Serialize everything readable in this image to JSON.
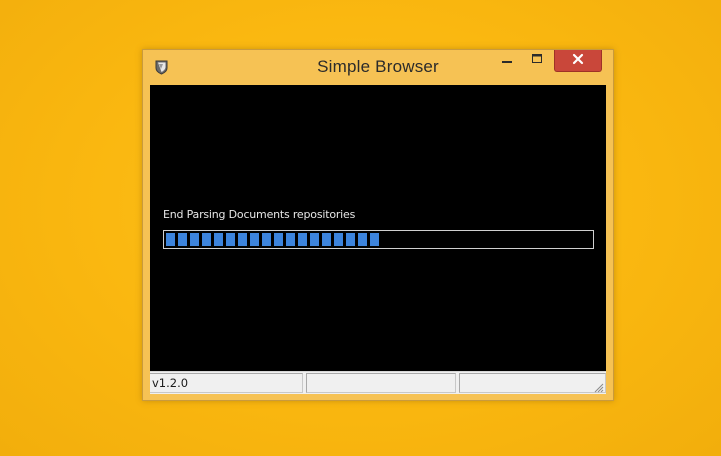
{
  "window": {
    "title": "Simple Browser",
    "app_icon": "shield-leaf-icon"
  },
  "titlebar_buttons": {
    "minimize_icon": "minimize-icon",
    "maximize_icon": "maximize-icon",
    "close_icon": "close-icon"
  },
  "content": {
    "status_message": "End Parsing Documents repositories",
    "progress_fraction": 0.49
  },
  "statusbar": {
    "version": "v1.2.0",
    "panel_2": "",
    "panel_3": ""
  },
  "colors": {
    "desktop": "#fbba12",
    "window_frame": "#f6c254",
    "close_button": "#c9473a",
    "progress_fill": "#3d84dc",
    "client_background": "#000000"
  }
}
